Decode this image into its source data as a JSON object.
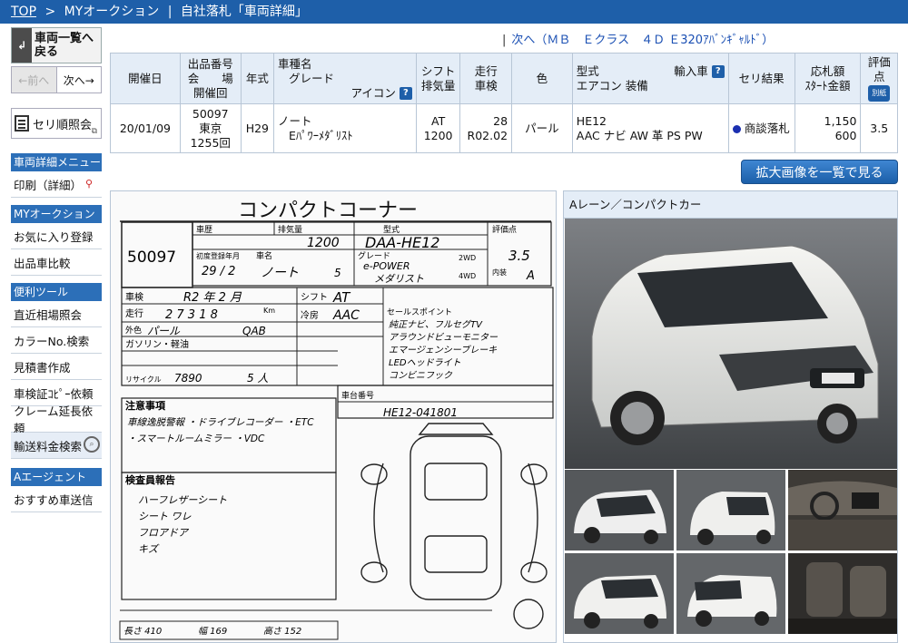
{
  "breadcrumb": {
    "top": "TOP",
    "sep": ">",
    "myauction": "MYオークション",
    "pipe": "|",
    "current": "自社落札「車両詳細」"
  },
  "sidebar": {
    "back_label_1": "車両一覧へ",
    "back_label_2": "戻る",
    "prev": "←前へ",
    "next": "次へ→",
    "seri": "セリ順照会",
    "menu_header": "車両詳細メニュー",
    "print": "印刷（詳細）",
    "myauction_header": "MYオークション",
    "favorite": "お気に入り登録",
    "compare": "出品車比較",
    "tools_header": "便利ツール",
    "market": "直近相場照会",
    "color_search": "カラーNo.検索",
    "estimate": "見積書作成",
    "shaken_copy": "車検証ｺﾋﾟｰ依頼",
    "claim": "クレーム延長依頼",
    "shipping": "輸送料金検索",
    "agent_header": "Aエージェント",
    "recommend": "おすすめ車送信"
  },
  "next_link": {
    "bar": "|",
    "text": "次へ（ＭＢ　Ｅクラス　４Ｄ Ｅ320ｱﾊﾞﾝｷﾞｬﾙﾄﾞ）"
  },
  "table": {
    "headers": {
      "date": "開催日",
      "lot_1": "出品番号",
      "lot_2": "会　　場",
      "lot_3": "開催回",
      "year": "年式",
      "name_1": "車種名",
      "name_2": "グレード",
      "name_3": "アイコン",
      "shift_1": "シフト",
      "shift_2": "排気量",
      "mileage_1": "走行",
      "mileage_2": "車検",
      "color": "色",
      "model_1": "型式",
      "model_import": "輸入車",
      "model_2": "エアコン 装備",
      "result": "セリ結果",
      "bid_1": "応札額",
      "bid_2": "ｽﾀｰﾄ金額",
      "score": "評価点",
      "score_badge": "別紙"
    },
    "row": {
      "date": "20/01/09",
      "lot": "50097",
      "venue": "東京",
      "round": "1255回",
      "year": "H29",
      "name": "ノート",
      "grade": "Eﾊﾟﾜｰﾒﾀﾞﾘｽﾄ",
      "shift": "AT",
      "displacement": "1200",
      "mileage": "28",
      "shaken": "R02.02",
      "color": "パール",
      "model": "HE12",
      "equipment": "AAC ナビ AW 革 PS PW",
      "result": "商談落札",
      "bid": "1,150",
      "start": "600",
      "score": "3.5"
    }
  },
  "big_button": "拡大画像を一覧で見る",
  "photo": {
    "header": "Aレーン／コンパクトカー"
  },
  "sheet": {
    "title": "コンパクトコーナー",
    "lot": "50097",
    "prior_label": "車歴",
    "displacement_label": "排気量",
    "displacement": "1200",
    "model_label": "型式",
    "model": "DAA-HE12",
    "score_label": "評価点",
    "score": "3.5",
    "year_label": "初度登録年月",
    "year": "29 / 2",
    "name_label": "車名",
    "name": "ノート",
    "doors": "5",
    "grade_label": "グレード",
    "grade_1": "e-POWER",
    "grade_2": "メダリスト",
    "door2": "2WD",
    "door4": "4WD",
    "interior_label": "内装",
    "interior": "A",
    "shaken_label": "車検",
    "shaken": "R2 年 2 月",
    "shift_label": "シフト",
    "shift": "AT",
    "mileage_label": "走行",
    "mileage": "2 7 3 1 8",
    "km": "Km",
    "ac_label": "冷房",
    "ac": "AAC",
    "color_label": "外色",
    "color": "パール",
    "color_no": "QAB",
    "fuel": "ガソリン・軽油",
    "recycle_label": "リサイクル",
    "recycle": "7890",
    "capacity": "5 人",
    "chassis_label": "車台番号",
    "chassis": "HE12-041801",
    "notes_label": "注意事項",
    "note_1": "車線逸脱警報 ・ドライブレコーダー ・ETC",
    "note_2": "・スマートルームミラー ・VDC",
    "sales_label": "セールスポイント",
    "sales_1": "純正ナビ、フルセグTV",
    "sales_2": "アラウンドビューモニター",
    "sales_3": "エマージェンシーブレーキ",
    "sales_4": "LEDヘッドライト",
    "sales_5": "コンビニフック",
    "inspect_label": "検査員報告",
    "inspect_1": "ハーフレザーシート",
    "inspect_2": "シート ワレ",
    "inspect_3": "フロアドア",
    "inspect_4": "キズ",
    "dims_1": "長さ 410",
    "dims_2": "幅 169",
    "dims_3": "高さ 152"
  }
}
